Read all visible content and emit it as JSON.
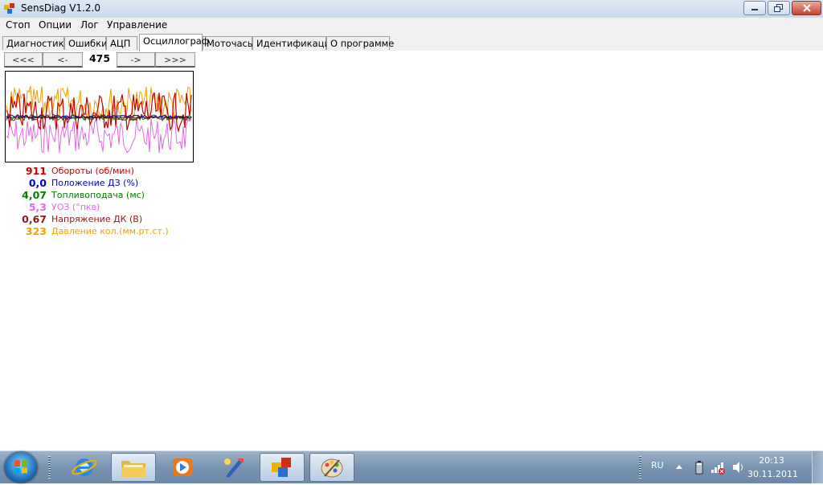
{
  "window": {
    "title": "SensDiag V1.2.0"
  },
  "menu": {
    "items": [
      "Стоп",
      "Опции",
      "Лог",
      "Управление"
    ]
  },
  "tabs": [
    "Диагностика",
    "Ошибки",
    "АЦП",
    "Осциллограф",
    "Моточасы",
    "Идентификация",
    "О программе"
  ],
  "active_tab": "Осциллограф",
  "nav": {
    "first": "<<<",
    "prev": "<-",
    "counter": "475",
    "next": "->",
    "last": ">>>"
  },
  "values": [
    {
      "value": "911",
      "label": "Обороты (об/мин)",
      "color": "#cc0000"
    },
    {
      "value": "0,0",
      "label": "Положение ДЗ (%)",
      "color": "#0000cc"
    },
    {
      "value": "4,07",
      "label": "Топливоподача (мс)",
      "color": "#008000"
    },
    {
      "value": "5,3",
      "label": "УОЗ (°пкв)",
      "color": "#e26ae2"
    },
    {
      "value": "0,67",
      "label": "Напряжение ДК (В)",
      "color": "#8b1a1a"
    },
    {
      "value": "323",
      "label": "Давление кол.(мм.рт.ст.)",
      "color": "#f0a000"
    }
  ],
  "taskbar": {
    "apps": [
      "internet-explorer",
      "explorer",
      "media-player",
      "paint-tool",
      "sensdiag",
      "paint"
    ],
    "active_apps": [
      "explorer",
      "sensdiag",
      "paint"
    ],
    "language": "RU",
    "time": "20:13",
    "date": "30.11.2011"
  }
}
